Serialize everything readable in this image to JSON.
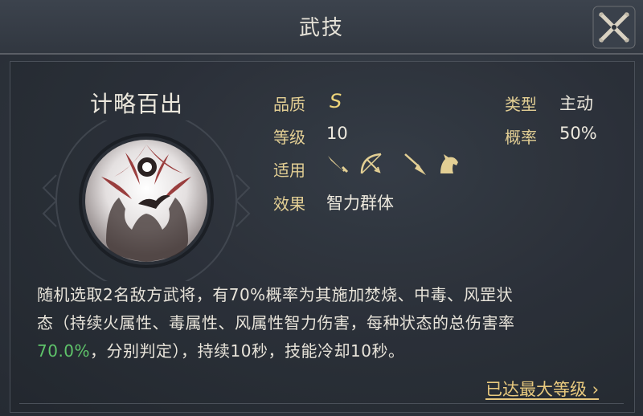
{
  "window": {
    "title": "武技"
  },
  "skill": {
    "name": "计略百出",
    "quality_label": "品质",
    "quality_value": "S",
    "level_label": "等级",
    "level_value": "10",
    "applicable_label": "适用",
    "applicable_icons": [
      "sword-icon",
      "bow-icon",
      "spear-icon",
      "horse-icon"
    ],
    "effect_label": "效果",
    "effect_value": "智力群体",
    "type_label": "类型",
    "type_value": "主动",
    "chance_label": "概率",
    "chance_value": "50%"
  },
  "description": {
    "line1": "随机选取2名敌方武将，有70%概率为其施加焚烧、中毒、风罡状",
    "line2": "态（持续火属性、毒属性、风属性智力伤害，每种状态的总伤害率",
    "line3_highlight": "70.0%",
    "line3_rest": "，分别判定），持续10秒，技能冷却10秒。"
  },
  "footer": {
    "max_level_link": "已达最大等级"
  },
  "colors": {
    "label": "#e3cf94",
    "highlight": "#5fc46a",
    "link": "#e8c97e"
  }
}
